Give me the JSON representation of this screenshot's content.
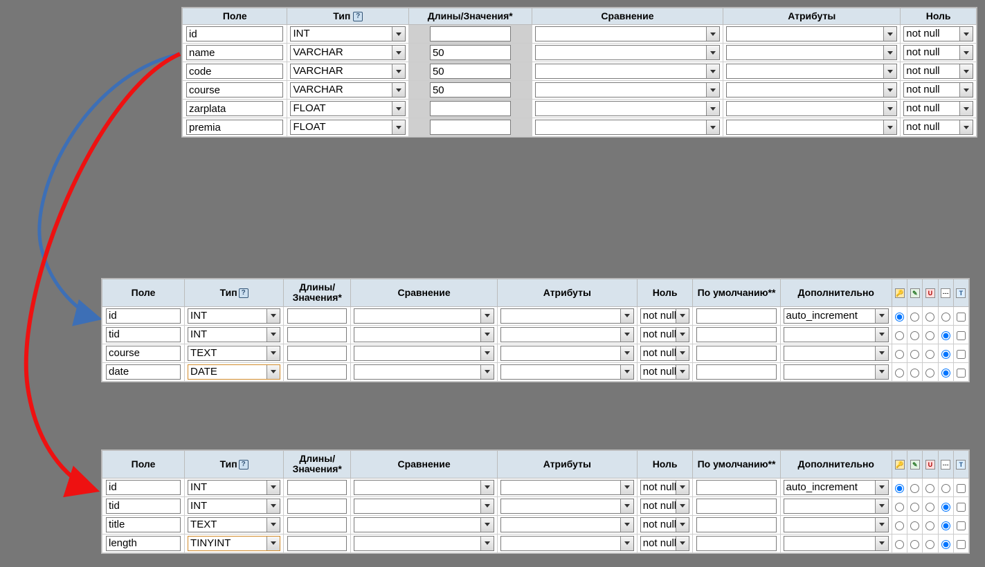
{
  "headers_basic": {
    "field": "Поле",
    "type": "Тип",
    "length": "Длины/Значения*",
    "collation": "Сравнение",
    "attributes": "Атрибуты",
    "null": "Ноль"
  },
  "headers_ext": {
    "field": "Поле",
    "type": "Тип",
    "length": "Длины/\nЗначения*",
    "collation": "Сравнение",
    "attributes": "Атрибуты",
    "null": "Ноль",
    "default": "По\nумолчанию**",
    "extra": "Дополнительно"
  },
  "help_icon": "?",
  "icon_keys": [
    "key",
    "edit",
    "unique",
    "dash",
    "fulltext"
  ],
  "table1": {
    "rows": [
      {
        "field": "id",
        "type": "INT",
        "length": "",
        "collation": "",
        "attributes": "",
        "null": "not null"
      },
      {
        "field": "name",
        "type": "VARCHAR",
        "length": "50",
        "collation": "",
        "attributes": "",
        "null": "not null"
      },
      {
        "field": "code",
        "type": "VARCHAR",
        "length": "50",
        "collation": "",
        "attributes": "",
        "null": "not null"
      },
      {
        "field": "course",
        "type": "VARCHAR",
        "length": "50",
        "collation": "",
        "attributes": "",
        "null": "not null"
      },
      {
        "field": "zarplata",
        "type": "FLOAT",
        "length": "",
        "collation": "",
        "attributes": "",
        "null": "not null"
      },
      {
        "field": "premia",
        "type": "FLOAT",
        "length": "",
        "collation": "",
        "attributes": "",
        "null": "not null"
      }
    ]
  },
  "table2": {
    "rows": [
      {
        "field": "id",
        "type": "INT",
        "length": "",
        "collation": "",
        "attributes": "",
        "null": "not null",
        "default": "",
        "extra": "auto_increment",
        "radio": 0,
        "hl": false
      },
      {
        "field": "tid",
        "type": "INT",
        "length": "",
        "collation": "",
        "attributes": "",
        "null": "not null",
        "default": "",
        "extra": "",
        "radio": 3,
        "hl": false
      },
      {
        "field": "course",
        "type": "TEXT",
        "length": "",
        "collation": "",
        "attributes": "",
        "null": "not null",
        "default": "",
        "extra": "",
        "radio": 3,
        "hl": false
      },
      {
        "field": "date",
        "type": "DATE",
        "length": "",
        "collation": "",
        "attributes": "",
        "null": "not null",
        "default": "",
        "extra": "",
        "radio": 3,
        "hl": true
      }
    ]
  },
  "table3": {
    "rows": [
      {
        "field": "id",
        "type": "INT",
        "length": "",
        "collation": "",
        "attributes": "",
        "null": "not null",
        "default": "",
        "extra": "auto_increment",
        "radio": 0,
        "hl": false
      },
      {
        "field": "tid",
        "type": "INT",
        "length": "",
        "collation": "",
        "attributes": "",
        "null": "not null",
        "default": "",
        "extra": "",
        "radio": 3,
        "hl": false
      },
      {
        "field": "title",
        "type": "TEXT",
        "length": "",
        "collation": "",
        "attributes": "",
        "null": "not null",
        "default": "",
        "extra": "",
        "radio": 3,
        "hl": false
      },
      {
        "field": "length",
        "type": "TINYINT",
        "length": "",
        "collation": "",
        "attributes": "",
        "null": "not null",
        "default": "",
        "extra": "",
        "radio": 3,
        "hl": true
      }
    ]
  }
}
